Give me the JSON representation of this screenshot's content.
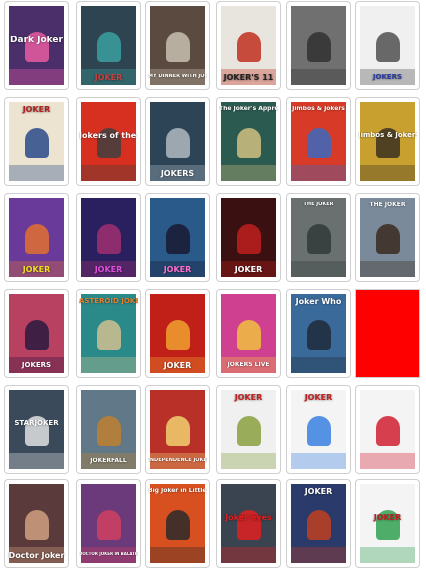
{
  "cards": [
    {
      "name": "card-dark-joker",
      "title": "Dark Joker",
      "bg": "#4a2f6b",
      "fg": "#ffffff",
      "accent": "#e85aa0",
      "frame": "#ffffff",
      "lpos": "mid",
      "lsize": "9px",
      "mode": "card"
    },
    {
      "name": "card-joker-gloom",
      "title": "JOKER",
      "bg": "#2e4450",
      "fg": "#c84040",
      "accent": "#3aa0a0",
      "frame": "#ffffff",
      "lpos": "bot",
      "lsize": "8px",
      "mode": "card"
    },
    {
      "name": "card-my-dinner",
      "title": "MY DINNER WITH JOKER",
      "bg": "#5a4a40",
      "fg": "#ffffff",
      "accent": "#c8c0b0",
      "frame": "#ffffff",
      "lpos": "bot",
      "lsize": "5px",
      "mode": "card"
    },
    {
      "name": "card-jokers-11",
      "title": "JOKER'S 11",
      "bg": "#e8e4de",
      "fg": "#222222",
      "accent": "#c03020",
      "frame": "#ffffff",
      "lpos": "bot",
      "lsize": "8px",
      "mode": "card"
    },
    {
      "name": "card-grey-band",
      "title": "",
      "bg": "#707070",
      "fg": "#ffffff",
      "accent": "#303030",
      "frame": "#ffffff",
      "lpos": "bot",
      "lsize": "8px",
      "mode": "card"
    },
    {
      "name": "card-jokers-band",
      "title": "JOKERS",
      "bg": "#f0f0f0",
      "fg": "#2a3aa0",
      "accent": "#505050",
      "frame": "#ffffff",
      "lpos": "bot",
      "lsize": "7px",
      "mode": "card"
    },
    {
      "name": "card-joker-mirror",
      "title": "JOKER",
      "bg": "#ece4d0",
      "fg": "#b02020",
      "accent": "#2a4a8a",
      "frame": "#ffffff",
      "lpos": "top",
      "lsize": "8px",
      "mode": "card"
    },
    {
      "name": "card-jokers-of-corn",
      "title": "Jokers of the Corn",
      "bg": "#d83020",
      "fg": "#ffffff",
      "accent": "#404040",
      "frame": "#ffffff",
      "lpos": "mid",
      "lsize": "8px",
      "mode": "card"
    },
    {
      "name": "card-jokers-jaws",
      "title": "JOKERS",
      "bg": "#2c4456",
      "fg": "#ffffff",
      "accent": "#b0b8c0",
      "frame": "#ffffff",
      "lpos": "bot",
      "lsize": "8px",
      "mode": "card"
    },
    {
      "name": "card-jokers-apprentice",
      "title": "The Joker's Apprentice",
      "bg": "#2a5a50",
      "fg": "#ffffff",
      "accent": "#d0c080",
      "frame": "#ffffff",
      "lpos": "top",
      "lsize": "6px",
      "mode": "card"
    },
    {
      "name": "card-jimbos-jokers-red",
      "title": "Jimbos & Jokers",
      "bg": "#d83a28",
      "fg": "#ffffff",
      "accent": "#3a6ac0",
      "frame": "#ffffff",
      "lpos": "top",
      "lsize": "6px",
      "mode": "card"
    },
    {
      "name": "card-jimbos-jokers-gold",
      "title": "Jimbos & Jokers",
      "bg": "#c8a030",
      "fg": "#ffffff",
      "accent": "#3a3020",
      "frame": "#ffffff",
      "lpos": "mid",
      "lsize": "7px",
      "mode": "card"
    },
    {
      "name": "card-joker-town",
      "title": "JOKER",
      "bg": "#6a3a9a",
      "fg": "#f0e020",
      "accent": "#e07030",
      "frame": "#ffffff",
      "lpos": "bot",
      "lsize": "8px",
      "mode": "card"
    },
    {
      "name": "card-joker-neon-purple",
      "title": "JOKER",
      "bg": "#2a2060",
      "fg": "#e050e0",
      "accent": "#a03070",
      "frame": "#ffffff",
      "lpos": "bot",
      "lsize": "8px",
      "mode": "card"
    },
    {
      "name": "card-joker-drive",
      "title": "JOKER",
      "bg": "#2a5a8a",
      "fg": "#ff70d0",
      "accent": "#1a1a30",
      "frame": "#ffffff",
      "lpos": "bot",
      "lsize": "8px",
      "mode": "card"
    },
    {
      "name": "card-joker-red-figure",
      "title": "JOKER",
      "bg": "#3a1010",
      "fg": "#ffffff",
      "accent": "#c02020",
      "frame": "#ffffff",
      "lpos": "bot",
      "lsize": "8px",
      "mode": "card"
    },
    {
      "name": "card-the-joker-noir",
      "title": "THE JOKER",
      "bg": "#6a7070",
      "fg": "#ffffff",
      "accent": "#303838",
      "frame": "#ffffff",
      "lpos": "top",
      "lsize": "5px",
      "mode": "card"
    },
    {
      "name": "card-the-joker-family",
      "title": "THE JOKER",
      "bg": "#7a8a9a",
      "fg": "#ffffff",
      "accent": "#3a2a20",
      "frame": "#ffffff",
      "lpos": "top",
      "lsize": "6px",
      "mode": "card"
    },
    {
      "name": "card-jokers-galaxy",
      "title": "JOKERS",
      "bg": "#b84060",
      "fg": "#ffffff",
      "accent": "#2a1a40",
      "frame": "#ffffff",
      "lpos": "bot",
      "lsize": "7px",
      "mode": "card"
    },
    {
      "name": "card-asteroid-joker",
      "title": "ASTEROID JOKER",
      "bg": "#2a8a8a",
      "fg": "#e08030",
      "accent": "#d0c090",
      "frame": "#ffffff",
      "lpos": "top",
      "lsize": "7px",
      "mode": "card"
    },
    {
      "name": "card-joker-vortex",
      "title": "JOKER",
      "bg": "#c02018",
      "fg": "#ffffff",
      "accent": "#f0a030",
      "frame": "#ffffff",
      "lpos": "bot",
      "lsize": "8px",
      "mode": "card"
    },
    {
      "name": "card-jokers-live",
      "title": "JOKERS LIVE",
      "bg": "#d04090",
      "fg": "#ffffff",
      "accent": "#f0c040",
      "frame": "#ffffff",
      "lpos": "bot",
      "lsize": "6px",
      "mode": "card"
    },
    {
      "name": "card-joker-who",
      "title": "Joker Who",
      "bg": "#3a6a9a",
      "fg": "#ffffff",
      "accent": "#202a3a",
      "frame": "#ffffff",
      "lpos": "top",
      "lsize": "8px",
      "mode": "card"
    },
    {
      "name": "card-placeholder-red",
      "title": "",
      "bg": "#ff0000",
      "fg": "#ffffff",
      "accent": "#ff0000",
      "frame": "#ff0000",
      "lpos": "bot",
      "lsize": "8px",
      "mode": "placeholder"
    },
    {
      "name": "card-starjoker",
      "title": "STARJOKER",
      "bg": "#3a4a5a",
      "fg": "#ffffff",
      "accent": "#e0e0e0",
      "frame": "#ffffff",
      "lpos": "mid",
      "lsize": "7px",
      "mode": "card"
    },
    {
      "name": "card-jokerfall",
      "title": "JOKERFALL",
      "bg": "#607888",
      "fg": "#ffffff",
      "accent": "#c08030",
      "frame": "#ffffff",
      "lpos": "bot",
      "lsize": "6px",
      "mode": "card"
    },
    {
      "name": "card-independence-joker",
      "title": "INDEPENDENCE JOKER",
      "bg": "#b83028",
      "fg": "#ffffff",
      "accent": "#f0d070",
      "frame": "#ffffff",
      "lpos": "bot",
      "lsize": "5px",
      "mode": "card"
    },
    {
      "name": "card-joker-jabba",
      "title": "JOKER",
      "bg": "#f0f0f0",
      "fg": "#c02020",
      "accent": "#88a040",
      "frame": "#ffffff",
      "lpos": "top",
      "lsize": "8px",
      "mode": "card"
    },
    {
      "name": "card-joker-smurf",
      "title": "JOKER",
      "bg": "#f4f4f4",
      "fg": "#c02020",
      "accent": "#3a80e0",
      "frame": "#ffffff",
      "lpos": "top",
      "lsize": "8px",
      "mode": "card"
    },
    {
      "name": "card-joker-shazam",
      "title": "",
      "bg": "#f4f4f4",
      "fg": "#c02020",
      "accent": "#d02030",
      "frame": "#ffffff",
      "lpos": "top",
      "lsize": "8px",
      "mode": "card"
    },
    {
      "name": "card-doctor-joker",
      "title": "Doctor Joker",
      "bg": "#5a3a3a",
      "fg": "#ffffff",
      "accent": "#d0a080",
      "frame": "#ffffff",
      "lpos": "bot",
      "lsize": "8px",
      "mode": "card"
    },
    {
      "name": "card-doctor-joker-balatro",
      "title": "DOCTOR JOKER IN BALATRO",
      "bg": "#6a3a7a",
      "fg": "#ffffff",
      "accent": "#d04060",
      "frame": "#ffffff",
      "lpos": "bot",
      "lsize": "4px",
      "mode": "card"
    },
    {
      "name": "card-big-joker-little-china",
      "title": "Big Joker in Little China",
      "bg": "#d85020",
      "fg": "#ffffff",
      "accent": "#2a2a2a",
      "frame": "#ffffff",
      "lpos": "top",
      "lsize": "6px",
      "mode": "card"
    },
    {
      "name": "card-joker-eyes",
      "title": "Joker eyes",
      "bg": "#3a4450",
      "fg": "#e02020",
      "accent": "#e02020",
      "frame": "#ffffff",
      "lpos": "mid",
      "lsize": "8px",
      "mode": "card"
    },
    {
      "name": "card-joker-night",
      "title": "JOKER",
      "bg": "#2a3a6a",
      "fg": "#ffffff",
      "accent": "#c04020",
      "frame": "#ffffff",
      "lpos": "top",
      "lsize": "8px",
      "mode": "card"
    },
    {
      "name": "card-joker-clown",
      "title": "JOKER",
      "bg": "#f4f4f4",
      "fg": "#c02020",
      "accent": "#30a050",
      "frame": "#ffffff",
      "lpos": "mid",
      "lsize": "8px",
      "mode": "card"
    }
  ]
}
